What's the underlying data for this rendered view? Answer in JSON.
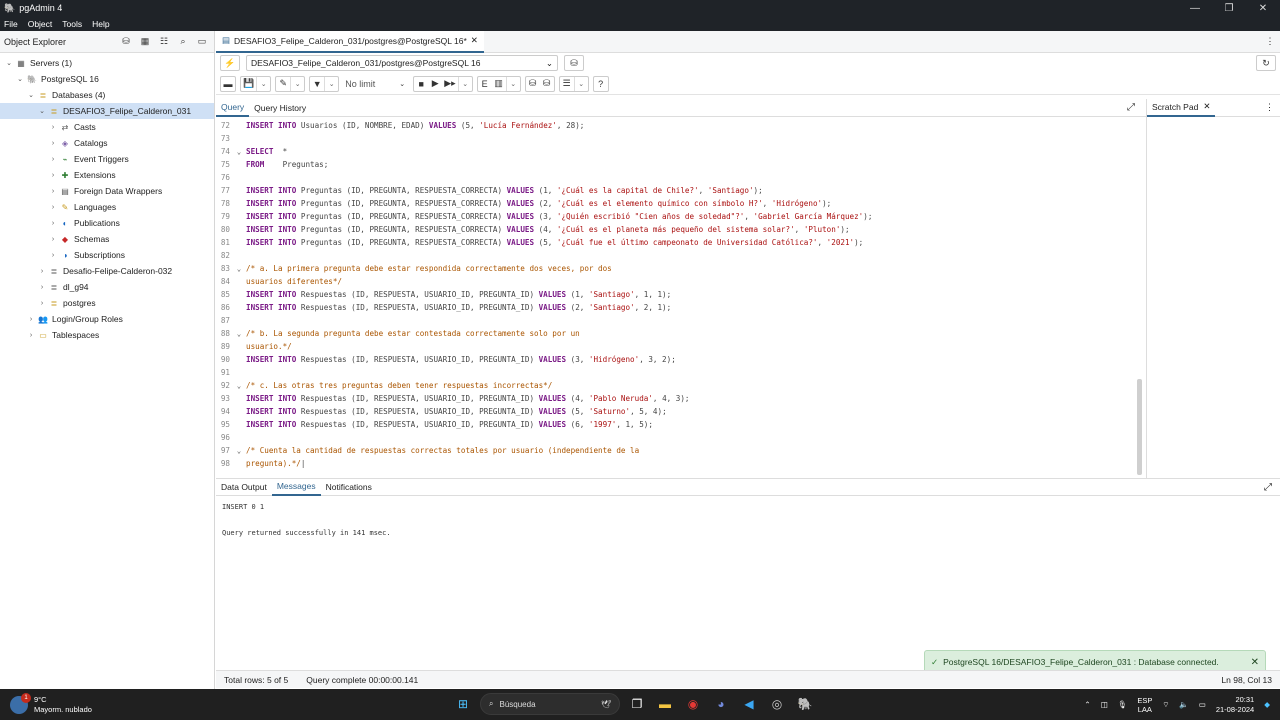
{
  "window": {
    "title": "pgAdmin 4",
    "controls": [
      "—",
      "❐",
      "✕"
    ]
  },
  "menu": [
    "File",
    "Object",
    "Tools",
    "Help"
  ],
  "object_explorer": {
    "title": "Object Explorer",
    "tools": [
      "database-icon",
      "table-icon",
      "columns-icon",
      "search-icon",
      "terminal-icon"
    ],
    "tree": [
      {
        "label": "Servers (1)",
        "depth": 0,
        "toggle": "⌄",
        "icon": "servers-icon",
        "glyph": "▦",
        "color": "#555"
      },
      {
        "label": "PostgreSQL 16",
        "depth": 1,
        "toggle": "⌄",
        "icon": "elephant-icon",
        "glyph": "🐘",
        "color": "#336791"
      },
      {
        "label": "Databases (4)",
        "depth": 2,
        "toggle": "⌄",
        "icon": "databases-icon",
        "glyph": "≣",
        "color": "#c79a1e"
      },
      {
        "label": "DESAFIO3_Felipe_Calderon_031",
        "depth": 3,
        "toggle": "⌄",
        "icon": "database-icon",
        "glyph": "≣",
        "color": "#c79a1e",
        "selected": true
      },
      {
        "label": "Casts",
        "depth": 4,
        "toggle": "›",
        "icon": "casts-icon",
        "glyph": "⇄",
        "color": "#555"
      },
      {
        "label": "Catalogs",
        "depth": 4,
        "toggle": "›",
        "icon": "catalogs-icon",
        "glyph": "◈",
        "color": "#7b5ea7"
      },
      {
        "label": "Event Triggers",
        "depth": 4,
        "toggle": "›",
        "icon": "event-trigger-icon",
        "glyph": "⌁",
        "color": "#2e7d32"
      },
      {
        "label": "Extensions",
        "depth": 4,
        "toggle": "›",
        "icon": "extensions-icon",
        "glyph": "✚",
        "color": "#2e7d32"
      },
      {
        "label": "Foreign Data Wrappers",
        "depth": 4,
        "toggle": "›",
        "icon": "fdw-icon",
        "glyph": "▤",
        "color": "#555"
      },
      {
        "label": "Languages",
        "depth": 4,
        "toggle": "›",
        "icon": "languages-icon",
        "glyph": "✎",
        "color": "#c79a1e"
      },
      {
        "label": "Publications",
        "depth": 4,
        "toggle": "›",
        "icon": "publications-icon",
        "glyph": "◐",
        "color": "#1565c0"
      },
      {
        "label": "Schemas",
        "depth": 4,
        "toggle": "›",
        "icon": "schemas-icon",
        "glyph": "◆",
        "color": "#c62828"
      },
      {
        "label": "Subscriptions",
        "depth": 4,
        "toggle": "›",
        "icon": "subscriptions-icon",
        "glyph": "◑",
        "color": "#1565c0"
      },
      {
        "label": "Desafio-Felipe-Calderon-032",
        "depth": 3,
        "toggle": "›",
        "icon": "database-icon",
        "glyph": "≣",
        "color": "#555"
      },
      {
        "label": "dl_g94",
        "depth": 3,
        "toggle": "›",
        "icon": "database-icon",
        "glyph": "≣",
        "color": "#555"
      },
      {
        "label": "postgres",
        "depth": 3,
        "toggle": "›",
        "icon": "database-icon",
        "glyph": "≣",
        "color": "#c79a1e"
      },
      {
        "label": "Login/Group Roles",
        "depth": 2,
        "toggle": "›",
        "icon": "roles-icon",
        "glyph": "👥",
        "color": "#555"
      },
      {
        "label": "Tablespaces",
        "depth": 2,
        "toggle": "›",
        "icon": "tablespaces-icon",
        "glyph": "▭",
        "color": "#c79a1e"
      }
    ]
  },
  "query_tab": {
    "label": "DESAFIO3_Felipe_Calderon_031/postgres@PostgreSQL 16*",
    "close": "✕"
  },
  "connection": {
    "label": "DESAFIO3_Felipe_Calderon_031/postgres@PostgreSQL 16",
    "caret": "⌄"
  },
  "toolbar": {
    "limit": "No limit"
  },
  "editor_tabs": [
    "Query",
    "Query History"
  ],
  "scratch": {
    "label": "Scratch Pad",
    "close": "✕"
  },
  "code_lines": [
    {
      "n": "72",
      "fold": "",
      "html": "<span class='kw'>INSERT INTO</span> Usuarios (ID, NOMBRE, EDAD) <span class='kw'>VALUES</span> (5, <span class='str'>'Lucía Fernández'</span>, 28);"
    },
    {
      "n": "73",
      "fold": "",
      "html": ""
    },
    {
      "n": "74",
      "fold": "⌄",
      "html": "<span class='kw'>SELECT</span>  *"
    },
    {
      "n": "75",
      "fold": "",
      "html": "<span class='kw'>FROM</span>    Preguntas;"
    },
    {
      "n": "76",
      "fold": "",
      "html": ""
    },
    {
      "n": "77",
      "fold": "",
      "html": "<span class='kw'>INSERT INTO</span> Preguntas (ID, PREGUNTA, RESPUESTA_CORRECTA) <span class='kw'>VALUES</span> (1, <span class='str'>'¿Cuál es la capital de Chile?'</span>, <span class='str'>'Santiago'</span>);"
    },
    {
      "n": "78",
      "fold": "",
      "html": "<span class='kw'>INSERT INTO</span> Preguntas (ID, PREGUNTA, RESPUESTA_CORRECTA) <span class='kw'>VALUES</span> (2, <span class='str'>'¿Cuál es el elemento químico con símbolo H?'</span>, <span class='str'>'Hidrógeno'</span>);"
    },
    {
      "n": "79",
      "fold": "",
      "html": "<span class='kw'>INSERT INTO</span> Preguntas (ID, PREGUNTA, RESPUESTA_CORRECTA) <span class='kw'>VALUES</span> (3, <span class='str'>'¿Quién escribió \"Cien años de soledad\"?'</span>, <span class='str'>'Gabriel García Márquez'</span>);"
    },
    {
      "n": "80",
      "fold": "",
      "html": "<span class='kw'>INSERT INTO</span> Preguntas (ID, PREGUNTA, RESPUESTA_CORRECTA) <span class='kw'>VALUES</span> (4, <span class='str'>'¿Cuál es el planeta más pequeño del sistema solar?'</span>, <span class='str'>'Pluton'</span>);"
    },
    {
      "n": "81",
      "fold": "",
      "html": "<span class='kw'>INSERT INTO</span> Preguntas (ID, PREGUNTA, RESPUESTA_CORRECTA) <span class='kw'>VALUES</span> (5, <span class='str'>'¿Cuál fue el último campeonato de Universidad Católica?'</span>, <span class='str'>'2021'</span>);"
    },
    {
      "n": "82",
      "fold": "",
      "html": ""
    },
    {
      "n": "83",
      "fold": "⌄",
      "html": "<span class='cmt'>/* a. La primera pregunta debe estar respondida correctamente dos veces, por dos</span>"
    },
    {
      "n": "84",
      "fold": "",
      "html": "<span class='cmt'>usuarios diferentes*/</span>"
    },
    {
      "n": "85",
      "fold": "",
      "html": "<span class='kw'>INSERT INTO</span> Respuestas (ID, RESPUESTA, USUARIO_ID, PREGUNTA_ID) <span class='kw'>VALUES</span> (1, <span class='str'>'Santiago'</span>, 1, 1);"
    },
    {
      "n": "86",
      "fold": "",
      "html": "<span class='kw'>INSERT INTO</span> Respuestas (ID, RESPUESTA, USUARIO_ID, PREGUNTA_ID) <span class='kw'>VALUES</span> (2, <span class='str'>'Santiago'</span>, 2, 1);"
    },
    {
      "n": "87",
      "fold": "",
      "html": ""
    },
    {
      "n": "88",
      "fold": "⌄",
      "html": "<span class='cmt'>/* b. La segunda pregunta debe estar contestada correctamente solo por un</span>"
    },
    {
      "n": "89",
      "fold": "",
      "html": "<span class='cmt'>usuario.*/</span>"
    },
    {
      "n": "90",
      "fold": "",
      "html": "<span class='kw'>INSERT INTO</span> Respuestas (ID, RESPUESTA, USUARIO_ID, PREGUNTA_ID) <span class='kw'>VALUES</span> (3, <span class='str'>'Hidrógeno'</span>, 3, 2);"
    },
    {
      "n": "91",
      "fold": "",
      "html": ""
    },
    {
      "n": "92",
      "fold": "⌄",
      "html": "<span class='cmt'>/* c. Las otras tres preguntas deben tener respuestas incorrectas*/</span>"
    },
    {
      "n": "93",
      "fold": "",
      "html": "<span class='kw'>INSERT INTO</span> Respuestas (ID, RESPUESTA, USUARIO_ID, PREGUNTA_ID) <span class='kw'>VALUES</span> (4, <span class='str'>'Pablo Neruda'</span>, 4, 3);"
    },
    {
      "n": "94",
      "fold": "",
      "html": "<span class='kw'>INSERT INTO</span> Respuestas (ID, RESPUESTA, USUARIO_ID, PREGUNTA_ID) <span class='kw'>VALUES</span> (5, <span class='str'>'Saturno'</span>, 5, 4);"
    },
    {
      "n": "95",
      "fold": "",
      "html": "<span class='kw'>INSERT INTO</span> Respuestas (ID, RESPUESTA, USUARIO_ID, PREGUNTA_ID) <span class='kw'>VALUES</span> (6, <span class='str'>'1997'</span>, 1, 5);"
    },
    {
      "n": "96",
      "fold": "",
      "html": ""
    },
    {
      "n": "97",
      "fold": "⌄",
      "html": "<span class='cmt'>/* Cuenta la cantidad de respuestas correctas totales por usuario (independiente de la</span>"
    },
    {
      "n": "98",
      "fold": "",
      "html": "<span class='cmt'>pregunta).*/</span>|"
    }
  ],
  "output_tabs": [
    "Data Output",
    "Messages",
    "Notifications"
  ],
  "messages": [
    "INSERT 0 1",
    "",
    "Query returned successfully in 141 msec."
  ],
  "status": {
    "rows": "Total rows: 5 of 5",
    "complete": "Query complete 00:00:00.141",
    "position": "Ln 98, Col 13"
  },
  "toast": {
    "text": "PostgreSQL 16/DESAFIO3_Felipe_Calderon_031 : Database connected."
  },
  "taskbar": {
    "temp": "9°C",
    "weather": "Mayorm. nublado",
    "badge": "1",
    "search": "Búsqueda",
    "lang1": "ESP",
    "lang2": "LAA",
    "time": "20:31",
    "date": "21-08-2024"
  }
}
